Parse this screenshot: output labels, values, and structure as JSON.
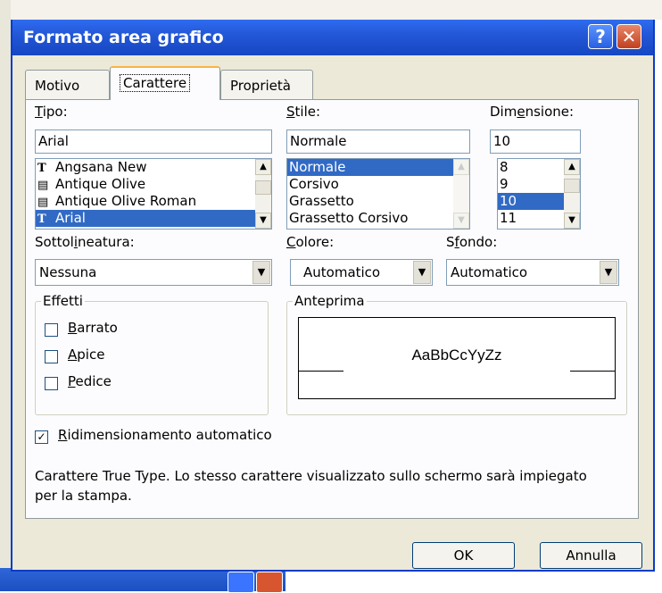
{
  "dialog": {
    "title": "Formato area grafico",
    "help_label": "?",
    "close_label": "✕"
  },
  "tabs": [
    {
      "label": "Motivo"
    },
    {
      "label": "Carattere"
    },
    {
      "label": "Proprietà"
    }
  ],
  "font": {
    "tipo_pre": "",
    "tipo_u": "T",
    "tipo_post": "ipo:",
    "value": "Arial",
    "list": [
      {
        "label": "Angsana New",
        "icon": "truetype-font-icon"
      },
      {
        "label": "Antique Olive",
        "icon": "printer-font-icon"
      },
      {
        "label": "Antique Olive Roman",
        "icon": "printer-font-icon"
      },
      {
        "label": "Arial",
        "icon": "truetype-font-icon",
        "selected": true
      }
    ]
  },
  "style": {
    "stile_u": "S",
    "stile_post": "tile:",
    "value": "Normale",
    "list": [
      {
        "label": "Normale",
        "selected": true
      },
      {
        "label": "Corsivo"
      },
      {
        "label": "Grassetto"
      },
      {
        "label": "Grassetto Corsivo"
      }
    ]
  },
  "size": {
    "dim_pre": "Dim",
    "dim_u": "e",
    "dim_post": "nsione:",
    "value": "10",
    "list": [
      {
        "label": "8"
      },
      {
        "label": "9"
      },
      {
        "label": "10",
        "selected": true
      },
      {
        "label": "11"
      }
    ]
  },
  "underline": {
    "pre": "Sottol",
    "u": "i",
    "post": "neatura:",
    "value": "Nessuna"
  },
  "color": {
    "u": "C",
    "post": "olore:",
    "value": "Automatico"
  },
  "background": {
    "pre": "S",
    "u": "f",
    "post": "ondo:",
    "value": "Automatico"
  },
  "effects": {
    "title": "Effetti",
    "items": [
      {
        "u": "B",
        "post": "arrato",
        "checked": false
      },
      {
        "u": "A",
        "post": "pice",
        "checked": false
      },
      {
        "u": "P",
        "post": "edice",
        "checked": false
      }
    ]
  },
  "preview": {
    "title": "Anteprima",
    "sample": "AaBbCcYyZz"
  },
  "autoscale": {
    "u": "R",
    "post": "idimensionamento automatico",
    "checked": true
  },
  "description": "Carattere True Type. Lo stesso carattere visualizzato sullo schermo sarà impiegato per la stampa.",
  "buttons": {
    "ok": "OK",
    "cancel": "Annulla"
  },
  "colors": {
    "title_bar": "#2358d8",
    "selection": "#316ac5",
    "dialog_bg": "#ece9d8",
    "panel_bg": "#fcfcfe"
  }
}
